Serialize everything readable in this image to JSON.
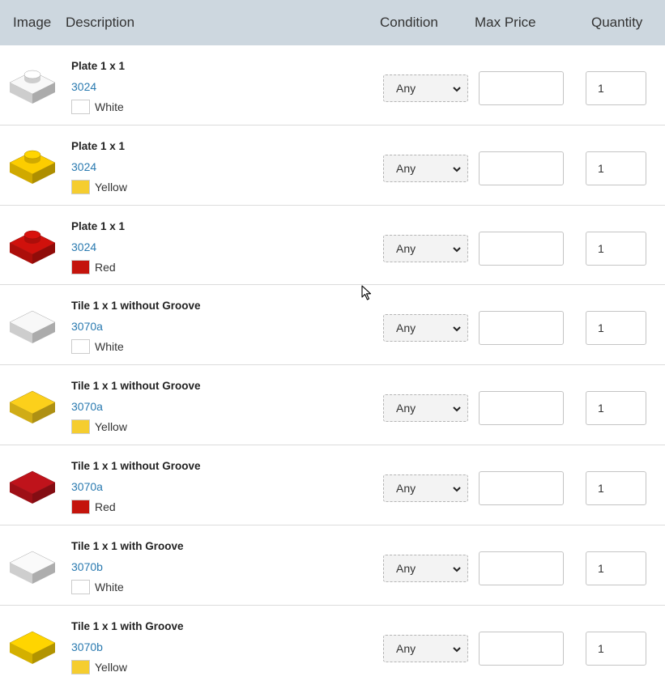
{
  "header": {
    "image": "Image",
    "description": "Description",
    "condition": "Condition",
    "max_price": "Max Price",
    "quantity": "Quantity"
  },
  "rows": [
    {
      "name": "Plate 1 x 1",
      "part": "3024",
      "color": "White",
      "swatch": "#ffffff",
      "brick": "plate",
      "brick_color": "#eeeeee",
      "condition": "Any",
      "max_price": "",
      "quantity": "1"
    },
    {
      "name": "Plate 1 x 1",
      "part": "3024",
      "color": "Yellow",
      "swatch": "#f5cd2f",
      "brick": "plate",
      "brick_color": "#f2c500",
      "condition": "Any",
      "max_price": "",
      "quantity": "1"
    },
    {
      "name": "Plate 1 x 1",
      "part": "3024",
      "color": "Red",
      "swatch": "#c4140c",
      "brick": "plate",
      "brick_color": "#c8100c",
      "condition": "Any",
      "max_price": "",
      "quantity": "1"
    },
    {
      "name": "Tile 1 x 1 without Groove",
      "part": "3070a",
      "color": "White",
      "swatch": "#ffffff",
      "brick": "tile",
      "brick_color": "#eeeeee",
      "condition": "Any",
      "max_price": "",
      "quantity": "1"
    },
    {
      "name": "Tile 1 x 1 without Groove",
      "part": "3070a",
      "color": "Yellow",
      "swatch": "#f5cd2f",
      "brick": "tile",
      "brick_color": "#f2c81a",
      "condition": "Any",
      "max_price": "",
      "quantity": "1"
    },
    {
      "name": "Tile 1 x 1 without Groove",
      "part": "3070a",
      "color": "Red",
      "swatch": "#c4140c",
      "brick": "tile",
      "brick_color": "#b8121a",
      "condition": "Any",
      "max_price": "",
      "quantity": "1"
    },
    {
      "name": "Tile 1 x 1 with Groove",
      "part": "3070b",
      "color": "White",
      "swatch": "#ffffff",
      "brick": "tile",
      "brick_color": "#f0f0f0",
      "condition": "Any",
      "max_price": "",
      "quantity": "1"
    },
    {
      "name": "Tile 1 x 1 with Groove",
      "part": "3070b",
      "color": "Yellow",
      "swatch": "#f5cd2f",
      "brick": "tile",
      "brick_color": "#f7cd00",
      "condition": "Any",
      "max_price": "",
      "quantity": "1"
    }
  ]
}
